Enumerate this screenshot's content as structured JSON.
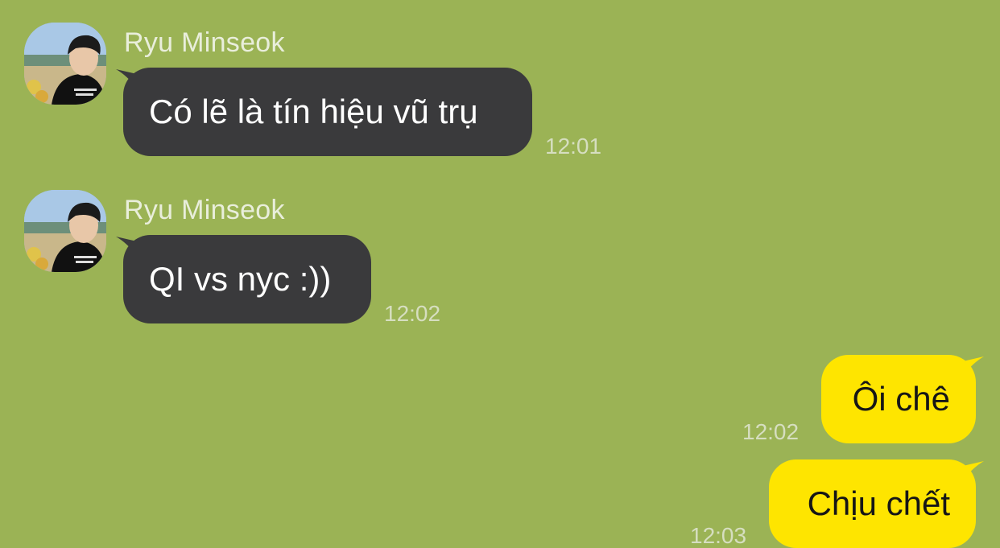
{
  "colors": {
    "background": "#9bb355",
    "incoming_bubble": "#3a3a3c",
    "outgoing_bubble": "#fee500",
    "timestamp": "#d6dec0",
    "sender_name": "#e9eedb"
  },
  "messages": [
    {
      "direction": "incoming",
      "sender": "Ryu Minseok",
      "avatar_icon": "profile-photo-icon",
      "text": "Có lẽ là tín hiệu vũ trụ",
      "time": "12:01"
    },
    {
      "direction": "incoming",
      "sender": "Ryu Minseok",
      "avatar_icon": "profile-photo-icon",
      "text": "QI vs nyc :))",
      "time": "12:02"
    },
    {
      "direction": "outgoing",
      "text": "Ôi chê",
      "time": "12:02"
    },
    {
      "direction": "outgoing",
      "text": "Chịu chết",
      "time": "12:03"
    }
  ]
}
